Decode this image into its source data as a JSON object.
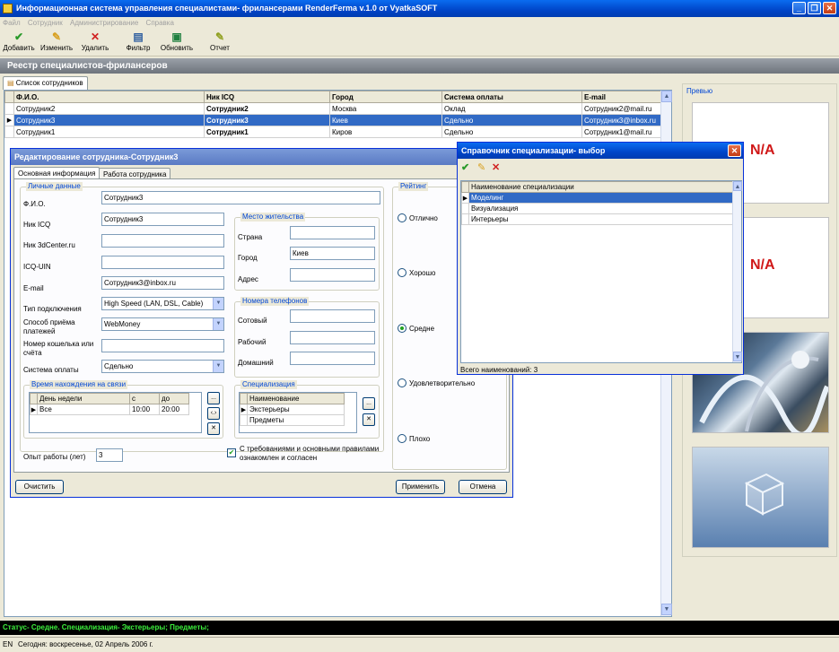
{
  "app": {
    "title": "Информационная система управления специалистами- фрилансерами RenderFerma v.1.0 от VyatkaSOFT",
    "window_buttons": {
      "minimize": "_",
      "maximize": "❐",
      "close": "✕"
    }
  },
  "menu": [
    "Файл",
    "Сотрудник",
    "Администрирование",
    "Справка"
  ],
  "toolbar": {
    "add": "Добавить",
    "edit": "Изменить",
    "delete": "Удалить",
    "filter": "Фильтр",
    "refresh": "Обновить",
    "report": "Отчет"
  },
  "header": {
    "title": "Реестр специалистов-фрилансеров"
  },
  "tabs": {
    "employees": "Список сотрудников"
  },
  "grid": {
    "columns": [
      "Ф.И.О.",
      "Ник ICQ",
      "Город",
      "Система оплаты",
      "E-mail"
    ],
    "rows": [
      [
        "Сотрудник2",
        "Сотрудник2",
        "Москва",
        "Оклад",
        "Сотрудник2@mail.ru"
      ],
      [
        "Сотрудник3",
        "Сотрудник3",
        "Киев",
        "Сдельно",
        "Сотрудник3@inbox.ru"
      ],
      [
        "Сотрудник1",
        "Сотрудник1",
        "Киров",
        "Сдельно",
        "Сотрудник1@mail.ru"
      ]
    ]
  },
  "preview": {
    "caption": "Превью",
    "na1": "N/A",
    "na2": "N/A"
  },
  "edit_dialog": {
    "title": "Редактирование сотрудника-Сотрудник3",
    "tabs": [
      "Основная информация",
      "Работа сотрудника"
    ],
    "personal": {
      "caption": "Личные данные",
      "fio_label": "Ф.И.О.",
      "fio": "Сотрудник3",
      "icq_label": "Ник ICQ",
      "icq": "Сотрудник3",
      "nick3d_label": "Ник 3dCenter.ru",
      "nick3d": "",
      "uin_label": "ICQ-UIN",
      "uin": "",
      "email_label": "E-mail",
      "email": "Сотрудник3@inbox.ru",
      "conn_label": "Тип подключения",
      "conn": "High Speed (LAN, DSL, Cable)",
      "pay_method_label": "Способ приёма платежей",
      "pay_method": "WebMoney",
      "wallet_label": "Номер кошелька или счёта",
      "wallet": "",
      "pay_system_label": "Система оплаты",
      "pay_system": "Сдельно"
    },
    "residence": {
      "caption": "Место жительства",
      "country_label": "Страна",
      "country": "",
      "city_label": "Город",
      "city": "Киев",
      "address_label": "Адрес",
      "address": ""
    },
    "phones": {
      "caption": "Номера телефонов",
      "mobile_label": "Сотовый",
      "mobile": "",
      "work_label": "Рабочий",
      "work": "",
      "home_label": "Домашний",
      "home": ""
    },
    "contact_time": {
      "caption": "Время нахождения на связи",
      "columns": [
        "День недели",
        "с",
        "до"
      ],
      "rows": [
        [
          "Все",
          "10:00",
          "20:00"
        ]
      ],
      "btn_more": "...",
      "btn_edit": "‹.›",
      "btn_del": "✕"
    },
    "specialization": {
      "caption": "Специализация",
      "column": "Наименование",
      "rows": [
        "Экстерьеры",
        "Предметы"
      ],
      "btn_more": "...",
      "btn_del": "✕"
    },
    "rating": {
      "caption": "Рейтинг",
      "options": [
        "Отлично",
        "Хорошо",
        "Средне",
        "Удовлетворительно",
        "Плохо"
      ],
      "selected": "Средне"
    },
    "experience_label": "Опыт работы (лет)",
    "experience": "3",
    "agree": "С требованиями и основными правилами ознакомлен и согласен",
    "clear": "Очистить",
    "apply": "Применить",
    "cancel": "Отмена"
  },
  "spec_dialog": {
    "title": "Справочник специализации- выбор",
    "close": "✕",
    "column": "Наименование специализации",
    "rows": [
      "Моделинг",
      "Визуализация",
      "Интерьеры"
    ],
    "selected": "Моделинг",
    "total": "Всего наименований: 3"
  },
  "status_line": "Статус- Средне. Специализация- Экстерьеры; Предметы;",
  "statusbar": {
    "lang": "EN",
    "date": "Сегодня: воскресенье, 02 Апрель 2006 г."
  },
  "colors": {
    "title": "#0045c8",
    "selection": "#316ac5",
    "status_text": "#3cf03c",
    "na": "#d01818"
  }
}
